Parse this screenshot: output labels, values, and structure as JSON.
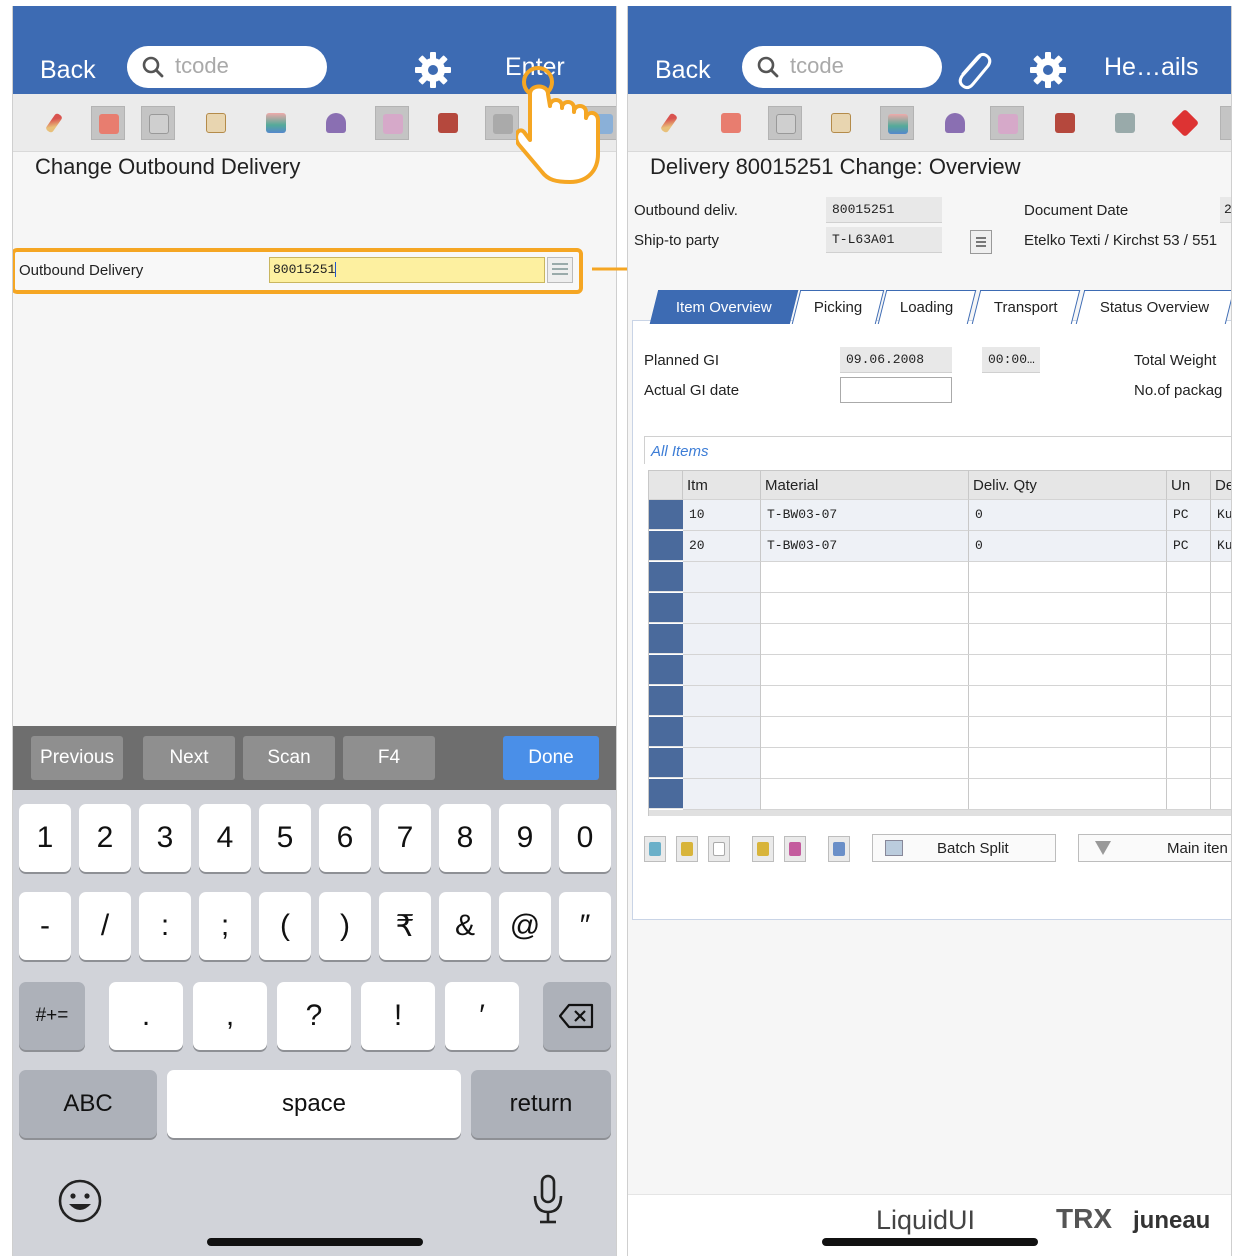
{
  "left": {
    "header": {
      "back_label": "Back",
      "search_placeholder": "tcode",
      "action_label": "Enter"
    },
    "screen_title": "Change Outbound Delivery",
    "field": {
      "label": "Outbound Delivery",
      "value": "80015251"
    },
    "keyboard_toolbar": {
      "previous": "Previous",
      "next": "Next",
      "scan": "Scan",
      "f4": "F4",
      "done": "Done"
    },
    "keyboard": {
      "row1": [
        "1",
        "2",
        "3",
        "4",
        "5",
        "6",
        "7",
        "8",
        "9",
        "0"
      ],
      "row2": [
        "-",
        "/",
        ":",
        ";",
        "(",
        ")",
        "₹",
        "&",
        "@",
        "″"
      ],
      "row3_mode": "#+=",
      "row3": [
        ".",
        ",",
        "?",
        "!",
        "′"
      ],
      "abc": "ABC",
      "space": "space",
      "return": "return"
    }
  },
  "right": {
    "header": {
      "back_label": "Back",
      "search_placeholder": "tcode",
      "action_label": "He…ails"
    },
    "screen_title": "Delivery 80015251 Change: Overview",
    "fields": {
      "outbound_label": "Outbound deliv.",
      "outbound_value": "80015251",
      "shipto_label": "Ship-to party",
      "shipto_value": "T-L63A01",
      "docdate_label": "Document Date",
      "docdate_value": "2",
      "shipto_name": "Etelko Texti / Kirchst 53 / 551"
    },
    "tabs": [
      "Item Overview",
      "Picking",
      "Loading",
      "Transport",
      "Status Overview"
    ],
    "planning": {
      "planned_gi_label": "Planned GI",
      "planned_gi_value": "09.06.2008",
      "planned_gi_time": "00:00…",
      "actual_gi_label": "Actual GI date",
      "actual_gi_value": "",
      "total_weight_label": "Total Weight",
      "packages_label": "No.of packag"
    },
    "items_title": "All Items",
    "table": {
      "columns": [
        "Itm",
        "Material",
        "Deliv. Qty",
        "Un",
        "De"
      ],
      "rows": [
        [
          "10",
          "T-BW03-07",
          "0",
          "PC",
          "Ku"
        ],
        [
          "20",
          "T-BW03-07",
          "0",
          "PC",
          "Ku"
        ]
      ]
    },
    "buttons": {
      "batch_split": "Batch Split",
      "main_item": "Main iten"
    },
    "footer": {
      "brand1": "LiquidUI",
      "brand2": "TRX",
      "brand3": "juneau"
    }
  },
  "colors": {
    "header_blue": "#3d6bb3",
    "highlight_orange": "#f5a623",
    "field_yellow": "#fdf0a0",
    "done_blue": "#4a8fe8"
  }
}
